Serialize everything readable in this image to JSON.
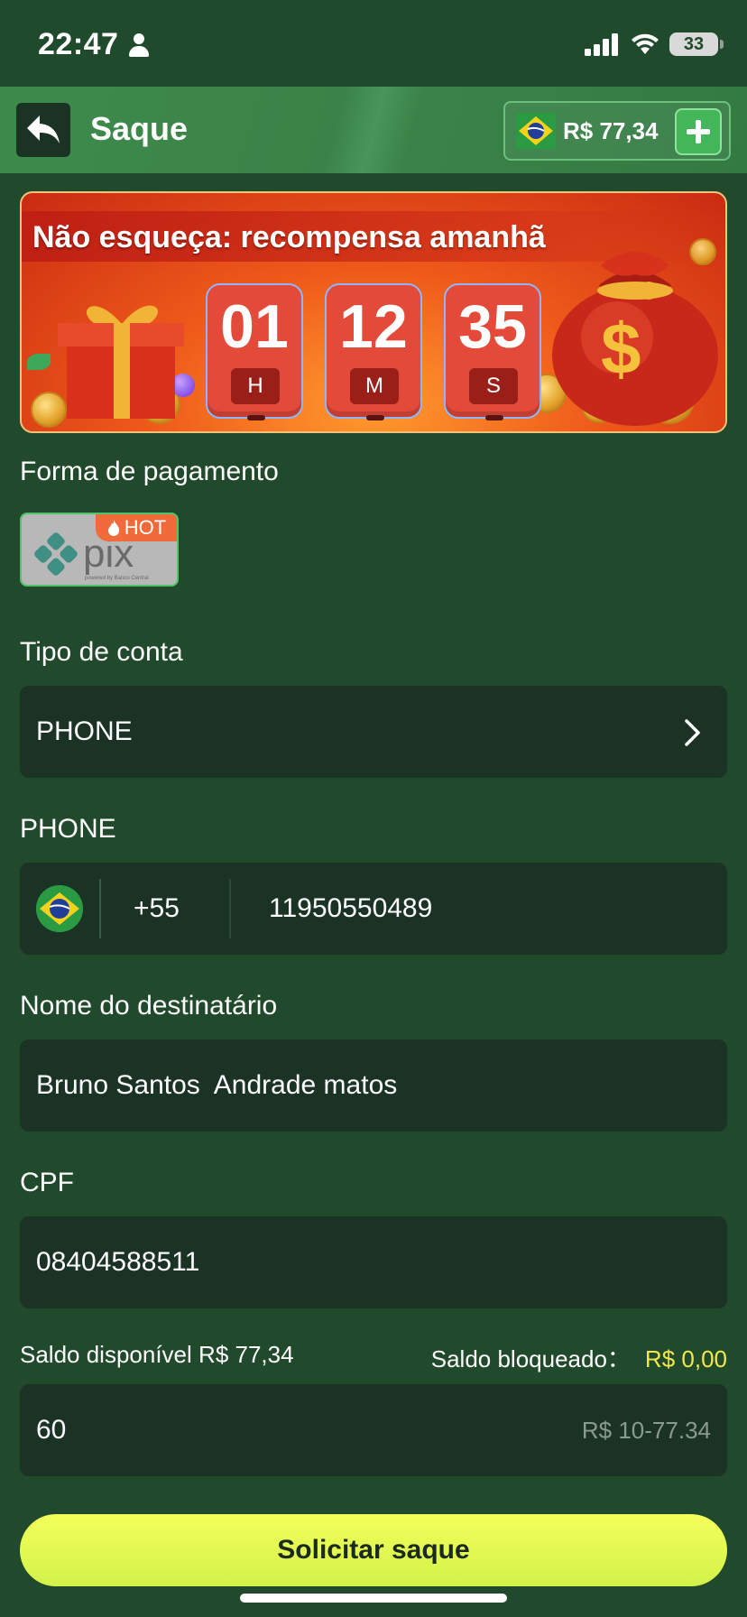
{
  "status_bar": {
    "time": "22:47",
    "battery": "33"
  },
  "header": {
    "title": "Saque",
    "balance": "R$ 77,34",
    "back_icon": "back-arrow-icon",
    "add_icon": "plus-icon"
  },
  "banner": {
    "title": "Não esqueça: recompensa amanhã",
    "timer": [
      {
        "value": "01",
        "unit": "H"
      },
      {
        "value": "12",
        "unit": "M"
      },
      {
        "value": "35",
        "unit": "S"
      }
    ]
  },
  "payment": {
    "label": "Forma de pagamento",
    "method_name": "pix",
    "method_sub": "powered by Banco Central",
    "badge": "HOT"
  },
  "account_type": {
    "label": "Tipo de conta",
    "value": "PHONE"
  },
  "phone": {
    "label": "PHONE",
    "country_code": "+55",
    "number": "11950550489"
  },
  "recipient": {
    "label": "Nome do destinatário",
    "value": "Bruno Santos  Andrade matos"
  },
  "cpf": {
    "label": "CPF",
    "value": "08404588511"
  },
  "balances": {
    "available_label": "Saldo disponível",
    "available_value": "R$ 77,34",
    "blocked_label": "Saldo bloqueado：",
    "blocked_value": "R$ 0,00"
  },
  "amount": {
    "value": "60",
    "hint": "R$ 10-77.34"
  },
  "submit_label": "Solicitar saque",
  "colors": {
    "background": "#214a2c",
    "header": "#3a8348",
    "field": "#1b3324",
    "accent_yellow": "#f1e84a",
    "button": "#e6ff52"
  }
}
